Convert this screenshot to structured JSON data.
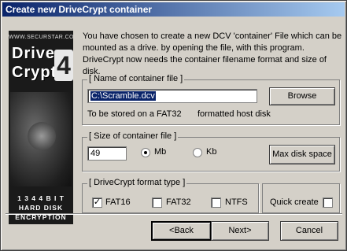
{
  "window": {
    "title": "Create new DriveCrypt container"
  },
  "banner": {
    "site": "WWW.SECURSTAR.COM",
    "word1": "Drive",
    "word2": "Crypt",
    "version": "4",
    "line1": "1 3 4 4 B I T",
    "line2": "HARD DISK",
    "line3": "ENCRYPTION"
  },
  "intro": "You have chosen to create a new DCV 'container' File which can be mounted as a drive. by opening the file, with this program. DriveCrypt now needs the container filename format and size of disk.",
  "name_group": {
    "legend": "[ Name of container file ]",
    "filename_value": "C:\\Scramble.dcv",
    "browse_label": "Browse",
    "stored_prefix": "To be stored on a",
    "fs_value": "FAT32",
    "stored_suffix": "formatted host disk"
  },
  "size_group": {
    "legend": "[ Size of container file ]",
    "size_value": "49",
    "unit_mb": "Mb",
    "unit_kb": "Kb",
    "selected_unit": "Mb",
    "max_label": "Max disk space"
  },
  "format_group": {
    "legend": "[ DriveCrypt format type ]",
    "fat16_label": "FAT16",
    "fat32_label": "FAT32",
    "ntfs_label": "NTFS",
    "fat16_checked": true,
    "fat32_checked": false,
    "ntfs_checked": false,
    "quick_label": "Quick create",
    "quick_checked": false
  },
  "buttons": {
    "back": "<Back",
    "next": "Next>",
    "cancel": "Cancel"
  }
}
